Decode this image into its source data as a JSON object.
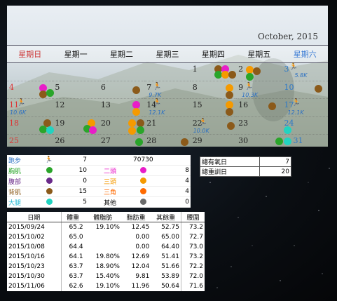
{
  "calendar": {
    "month_label": "October, 2015",
    "weekdays": [
      "星期日",
      "星期一",
      "星期二",
      "星期三",
      "星期四",
      "星期五",
      "星期六"
    ],
    "weeks": [
      [
        "",
        "",
        "",
        "",
        "1",
        "2",
        "3"
      ],
      [
        "4",
        "5",
        "6",
        "7",
        "8",
        "9",
        "10"
      ],
      [
        "11",
        "12",
        "13",
        "14",
        "15",
        "16",
        "17"
      ],
      [
        "18",
        "19",
        "20",
        "21",
        "22",
        "23",
        "24"
      ],
      [
        "25",
        "26",
        "27",
        "28",
        "29",
        "30",
        "31"
      ]
    ],
    "run_labels": {
      "d3": "5.8K",
      "d7": "9.7K",
      "d9": "10.3K",
      "d11": "10.6K",
      "d14": "12.1K",
      "d17": "12.1K",
      "d22": "10.0K"
    },
    "colors": {
      "chest": "#2aa52a",
      "back": "#8b5a1a",
      "abs": "#6a2a8a",
      "legs": "#22d3c0",
      "biceps": "#e81ec8",
      "triceps": "#f59a00",
      "shoulders": "#ff6a00",
      "other": "#6b6b6b",
      "run": "#2a6fc2"
    }
  },
  "legend": {
    "rows": [
      {
        "name": "跑步",
        "count": "7",
        "name2": "",
        "count2": "70730"
      },
      {
        "name": "胸肌",
        "count": "10",
        "name2": "二頭",
        "count2": "8"
      },
      {
        "name": "腹部",
        "count": "0",
        "name2": "三頭",
        "count2": "4"
      },
      {
        "name": "背肌",
        "count": "15",
        "name2": "三角",
        "count2": "4"
      },
      {
        "name": "大腿",
        "count": "5",
        "name2": "其他",
        "count2": "0"
      }
    ]
  },
  "summary": {
    "rows": [
      {
        "label": "總有氧日",
        "value": "7"
      },
      {
        "label": "總重訓日",
        "value": "20"
      }
    ]
  },
  "weight_table": {
    "headers": [
      "日期",
      "體重",
      "體脂肪",
      "脂肪重",
      "其餘重",
      "腰圍"
    ],
    "rows": [
      [
        "2015/09/24",
        "65.2",
        "19.10%",
        "12.45",
        "52.75",
        "73.2"
      ],
      [
        "2015/10/02",
        "65.0",
        "",
        "0.00",
        "65.00",
        "72.7"
      ],
      [
        "2015/10/08",
        "64.4",
        "",
        "0.00",
        "64.40",
        "73.0"
      ],
      [
        "2015/10/16",
        "64.1",
        "19.80%",
        "12.69",
        "51.41",
        "73.2"
      ],
      [
        "2015/10/23",
        "63.7",
        "18.90%",
        "12.04",
        "51.66",
        "72.2"
      ],
      [
        "2015/10/30",
        "63.7",
        "15.40%",
        "9.81",
        "53.89",
        "72.0"
      ],
      [
        "2015/11/06",
        "62.6",
        "19.10%",
        "11.96",
        "50.64",
        "71.6"
      ]
    ]
  }
}
